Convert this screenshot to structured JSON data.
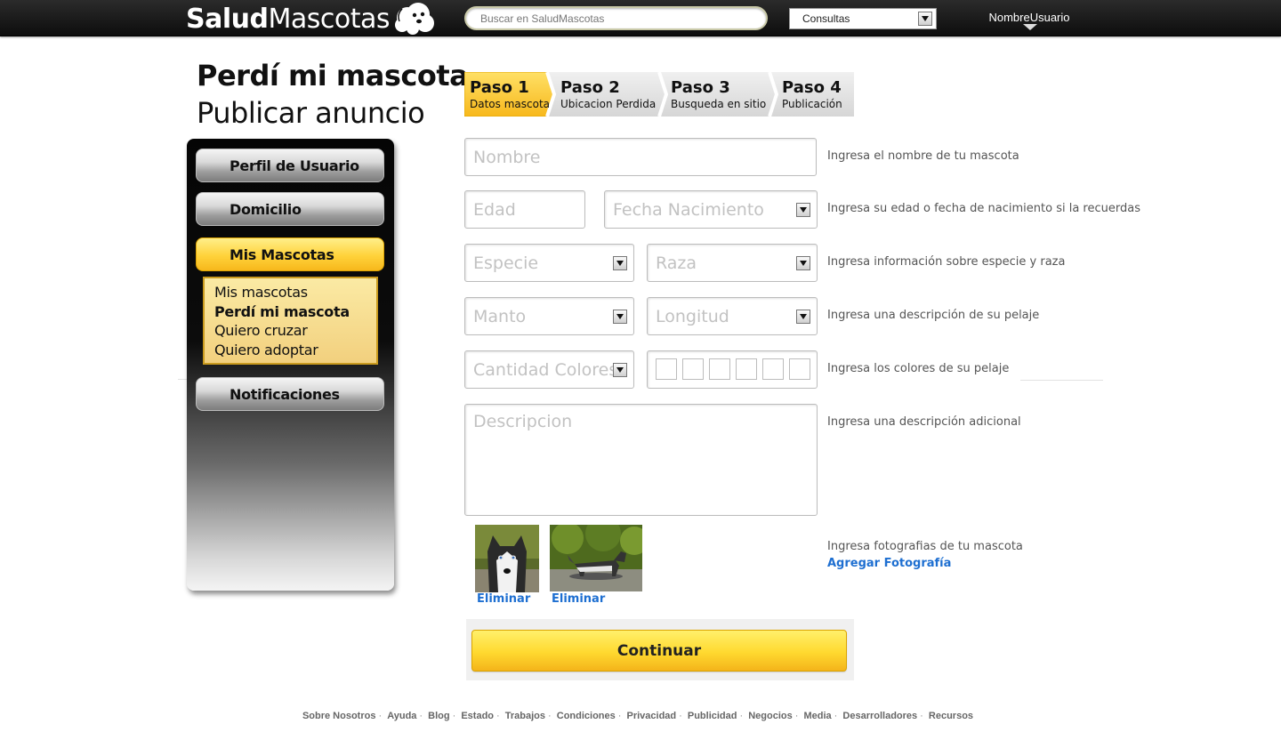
{
  "brand": {
    "bold": "Salud",
    "light": "Mascotas"
  },
  "header": {
    "search_placeholder": "Buscar en SaludMascotas",
    "consult_value": "Consultas",
    "user_name": "NombreUsuario"
  },
  "page": {
    "title": "Perdí mi mascota",
    "subtitle": "Publicar anuncio"
  },
  "sidebar": {
    "items": [
      {
        "label": "Perfil de Usuario"
      },
      {
        "label": "Domicilio"
      },
      {
        "label": "Mis Mascotas"
      },
      {
        "label": "Notificaciones"
      }
    ],
    "submenu": [
      {
        "label": "Mis mascotas"
      },
      {
        "label": "Perdí mi mascota"
      },
      {
        "label": "Quiero cruzar"
      },
      {
        "label": "Quiero adoptar"
      }
    ]
  },
  "steps": [
    {
      "num": "Paso 1",
      "label": "Datos mascota"
    },
    {
      "num": "Paso 2",
      "label": "Ubicacion Perdida"
    },
    {
      "num": "Paso 3",
      "label": "Busqueda en sitio"
    },
    {
      "num": "Paso 4",
      "label": "Publicación"
    }
  ],
  "form": {
    "nombre": "Nombre",
    "edad": "Edad",
    "fecha": "Fecha Nacimiento",
    "especie": "Especie",
    "raza": "Raza",
    "manto": "Manto",
    "longitud": "Longitud",
    "cantidad": "Cantidad Colores",
    "descripcion": "Descripcion"
  },
  "help": {
    "nombre": "Ingresa el nombre de tu mascota",
    "edad": "Ingresa su edad o fecha de nacimiento si la recuerdas",
    "especie": "Ingresa información sobre especie y raza",
    "manto": "Ingresa una descripción de su pelaje",
    "colores": "Ingresa los colores de su pelaje",
    "descripcion": "Ingresa una descripción adicional",
    "fotos": "Ingresa fotografias de tu mascota"
  },
  "photos": {
    "delete": "Eliminar",
    "add": "Agregar Fotografía"
  },
  "continue_label": "Continuar",
  "footer": [
    "Sobre Nosotros",
    "Ayuda",
    "Blog",
    "Estado",
    "Trabajos",
    "Condiciones",
    "Privacidad",
    "Publicidad",
    "Negocios",
    "Media",
    "Desarrolladores",
    "Recursos"
  ],
  "colors": {
    "accent": "#ffd23a",
    "link": "#1e6fd1",
    "topbar": "#111111"
  },
  "icons": [
    "dog-logo-icon",
    "dropdown-arrow-icon",
    "user-caret-icon"
  ]
}
